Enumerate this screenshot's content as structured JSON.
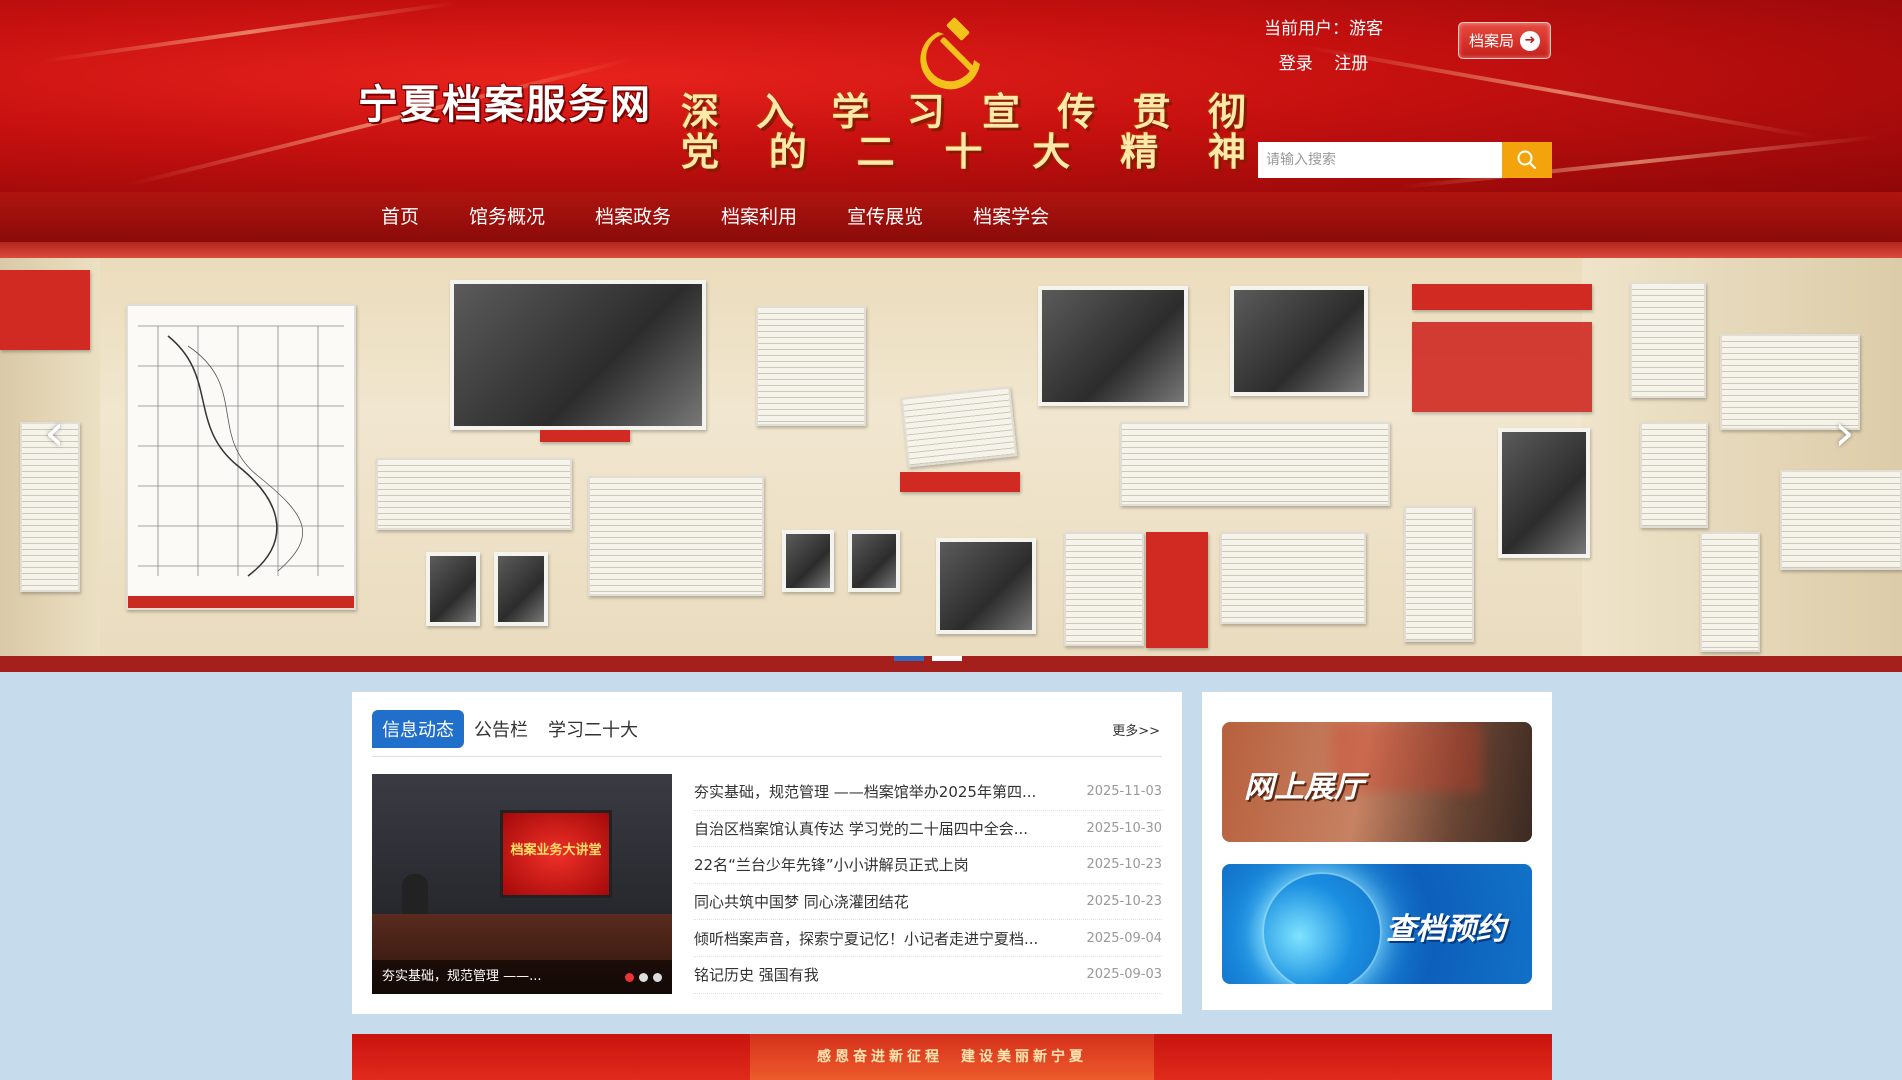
{
  "header": {
    "site_title": "宁夏档案服务网",
    "slogan_line1": [
      "深",
      "入",
      "学",
      "习",
      "宣",
      "传",
      "贯",
      "彻"
    ],
    "slogan_line2": [
      "党",
      "的",
      "二",
      "十",
      "大",
      "精",
      "神"
    ],
    "current_user": "当前用户：游客",
    "login": "登录",
    "register": "注册",
    "bureau_button": "档案局",
    "search_placeholder": "请输入搜索",
    "brand_color": "#c4100f"
  },
  "nav": {
    "items": [
      "首页",
      "馆务概况",
      "档案政务",
      "档案利用",
      "宣传展览",
      "档案学会"
    ]
  },
  "banner": {
    "slide_count": 2,
    "active_slide": 1
  },
  "news": {
    "tabs": [
      "信息动态",
      "公告栏",
      "学习二十大"
    ],
    "active_tab": 0,
    "more": "更多>>",
    "image_caption": "夯实基础，规范管理 ——...",
    "image_screen_text": "档案业务大讲堂",
    "items": [
      {
        "title": "夯实基础，规范管理 ——档案馆举办2025年第四...",
        "date": "2025-11-03"
      },
      {
        "title": "自治区档案馆认真传达 学习党的二十届四中全会...",
        "date": "2025-10-30"
      },
      {
        "title": "22名“兰台少年先锋”小小讲解员正式上岗",
        "date": "2025-10-23"
      },
      {
        "title": "同心共筑中国梦 同心浇灌团结花",
        "date": "2025-10-23"
      },
      {
        "title": "倾听档案声音，探索宁夏记忆！小记者走进宁夏档...",
        "date": "2025-09-04"
      },
      {
        "title": "铭记历史 强国有我",
        "date": "2025-09-03"
      }
    ]
  },
  "side": {
    "promo1": "网上展厅",
    "promo2": "查档预约"
  },
  "bottom_banner": {
    "text": "感恩奋进新征程　建设美丽新宁夏"
  }
}
